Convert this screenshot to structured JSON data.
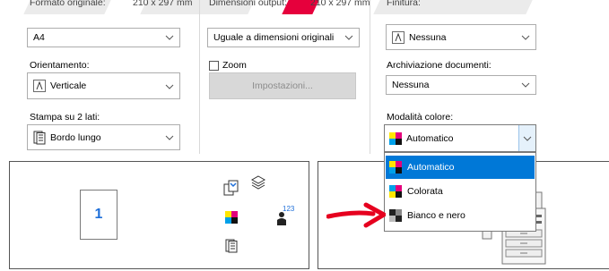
{
  "labels": {
    "original_format": "Formato originale:",
    "original_size": "210 x 297 mm",
    "output_dimensions": "Dimensioni output:",
    "output_size": "210 x 297 mm",
    "finishing": "Finitura:",
    "orientation": "Orientamento:",
    "zoom": "Zoom",
    "doc_archiving": "Archiviazione documenti:",
    "duplex": "Stampa su 2 lati:",
    "color_mode": "Modalità colore:"
  },
  "fields": {
    "original_format": "A4",
    "output_dimensions": "Uguale a dimensioni originali",
    "finishing": "Nessuna",
    "orientation": "Verticale",
    "doc_archiving": "Nessuna",
    "duplex": "Bordo lungo",
    "color_mode": "Automatico"
  },
  "buttons": {
    "settings": "Impostazioni..."
  },
  "zoom_checked": false,
  "preview": {
    "page_number": "1",
    "stack_counter": "123"
  },
  "color_options": [
    {
      "label": "Automatico",
      "selected": true,
      "icon": "auto-color-icon"
    },
    {
      "label": "Colorata",
      "selected": false,
      "icon": "color-icon"
    },
    {
      "label": "Bianco e nero",
      "selected": false,
      "icon": "black-white-icon"
    }
  ],
  "colors": {
    "accent": "#0078d7",
    "annotation_arrow": "#e6001f",
    "brand_red": "#e6003c",
    "page_number": "#1e6fd9"
  }
}
